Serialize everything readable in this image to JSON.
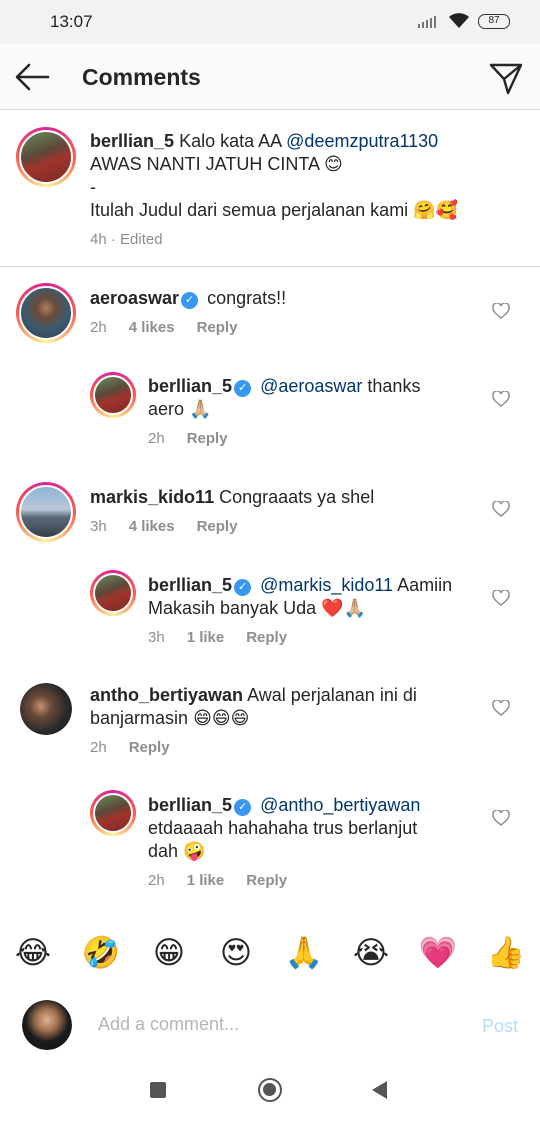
{
  "status_bar": {
    "time": "13:07",
    "battery": "87"
  },
  "header": {
    "title": "Comments"
  },
  "caption": {
    "username": "berllian_5",
    "line1_prefix": "Kalo kata AA",
    "line1_mention": "@deemzputra1130",
    "line2": "AWAS NANTI JATUH CINTA",
    "line2_emoji": "😊",
    "line3": "-",
    "line4": "Itulah Judul dari semua perjalanan kami",
    "line4_emoji": "🤗🥰",
    "meta": "4h · Edited"
  },
  "comments": [
    {
      "username": "aeroaswar",
      "text": "congrats!!",
      "time": "2h",
      "likes": "4 likes",
      "reply": "Reply"
    },
    {
      "username": "berllian_5",
      "mention": "@aeroaswar",
      "text": "thanks",
      "text2": "aero",
      "emoji": "🙏🏼",
      "time": "2h",
      "reply": "Reply"
    },
    {
      "username": "markis_kido11",
      "text": "Congraaats ya shel",
      "time": "3h",
      "likes": "4 likes",
      "reply": "Reply"
    },
    {
      "username": "berllian_5",
      "mention": "@markis_kido11",
      "text": "Aamiin",
      "text2": "Makasih banyak Uda",
      "emoji": "❤️🙏🏼",
      "time": "3h",
      "likes": "1 like",
      "reply": "Reply"
    },
    {
      "username": "antho_bertiyawan",
      "text": "Awal perjalanan ini di",
      "text2": "banjarmasin",
      "emoji": "😄😄😄",
      "time": "2h",
      "reply": "Reply"
    },
    {
      "username": "berllian_5",
      "mention": "@antho_bertiyawan",
      "text": "etdaaaah hahahaha trus berlanjut",
      "text2": "dah",
      "emoji": "🤪",
      "time": "2h",
      "likes": "1 like",
      "reply": "Reply"
    }
  ],
  "emoji_bar": [
    "😂",
    "🤣",
    "😁",
    "😍",
    "🙏",
    "😭",
    "💗",
    "👍"
  ],
  "composer": {
    "placeholder": "Add a comment...",
    "post": "Post"
  },
  "colors": {
    "link": "#00376b",
    "meta": "#8e8e8e",
    "post_disabled": "#b3dbff",
    "verified": "#3897f0"
  },
  "icons": [
    "back-arrow-icon",
    "send-icon",
    "heart-outline-icon",
    "verified-badge-icon",
    "wifi-icon",
    "signal-icon",
    "battery-icon"
  ]
}
